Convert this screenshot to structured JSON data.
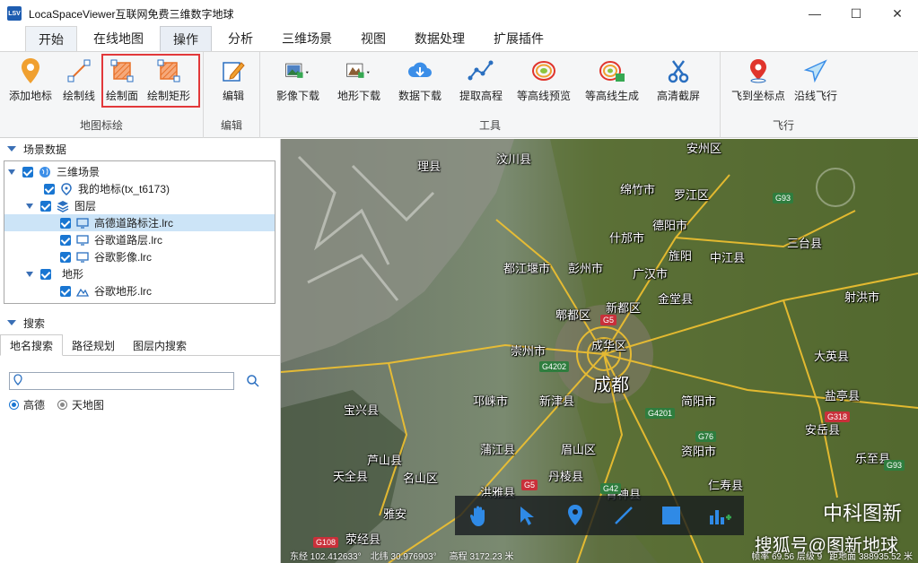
{
  "window": {
    "icon_text": "LSV",
    "title": "LocaSpaceViewer互联网免费三维数字地球",
    "minimize": "—",
    "maximize": "☐",
    "close": "✕"
  },
  "menu": {
    "tabs": [
      "开始",
      "在线地图",
      "操作",
      "分析",
      "三维场景",
      "视图",
      "数据处理",
      "扩展插件"
    ]
  },
  "ribbon": {
    "groups": {
      "map_draw": "地图标绘",
      "edit": "编辑",
      "tools": "工具",
      "fly": "飞行"
    },
    "buttons": {
      "add_marker": "添加地标",
      "draw_line": "绘制线",
      "draw_polygon": "绘制面",
      "draw_rect": "绘制矩形",
      "edit": "编辑",
      "image_download": "影像下载",
      "terrain_download": "地形下载",
      "data_download": "数据下载",
      "extract_elevation": "提取高程",
      "contour_preview": "等高线预览",
      "contour_generate": "等高线生成",
      "hd_screenshot": "高清截屏",
      "fly_to_coord": "飞到坐标点",
      "fly_along_line": "沿线飞行"
    }
  },
  "scene_panel": {
    "header": "场景数据",
    "items": {
      "root": "三维场景",
      "my_markers": "我的地标(tx_t6173)",
      "layers": "图层",
      "layer1": "高德道路标注.lrc",
      "layer2": "谷歌道路层.lrc",
      "layer3": "谷歌影像.lrc",
      "terrain": "地形",
      "terrain1": "谷歌地形.lrc"
    }
  },
  "search_panel": {
    "header": "搜索",
    "tabs": [
      "地名搜索",
      "路径规划",
      "图层内搜索"
    ],
    "input_value": "",
    "options": [
      "高德",
      "天地图"
    ]
  },
  "map": {
    "places": [
      "理县",
      "汶川县",
      "安州区",
      "罗江区",
      "绵竹市",
      "德阳市",
      "什邡市",
      "旌阳",
      "中江县",
      "三台县",
      "都江堰市",
      "彭州市",
      "广汉市",
      "射洪市",
      "郫都区",
      "新都区",
      "金堂县",
      "崇州市",
      "成华区",
      "成都",
      "大英县",
      "邛崃市",
      "新津县",
      "简阳市",
      "宝兴县",
      "蒲江县",
      "眉山区",
      "资阳市",
      "安岳县",
      "天全县",
      "名山区",
      "丹棱县",
      "芦山县",
      "洪雅县",
      "雅安",
      "青神县",
      "荥经县",
      "盐亭县",
      "乐至县",
      "仁寿县"
    ],
    "shields": [
      "G93",
      "G5",
      "G4202",
      "G4201",
      "G76",
      "G5",
      "G42",
      "G318",
      "G108",
      "G93"
    ],
    "status": {
      "lon": "东经 102.412633°",
      "lat": "北纬 30.976903°",
      "alt": "高程 3172.23 米",
      "fps": "帧率 69.56 层级 9",
      "dist": "距地面 388935.52 米"
    },
    "watermark_brand": "中科图新",
    "watermark_source": "搜狐号@图新地球"
  },
  "colors": {
    "accent": "#1976d2",
    "highlight": "#e2383a",
    "road": "#f2c230"
  }
}
